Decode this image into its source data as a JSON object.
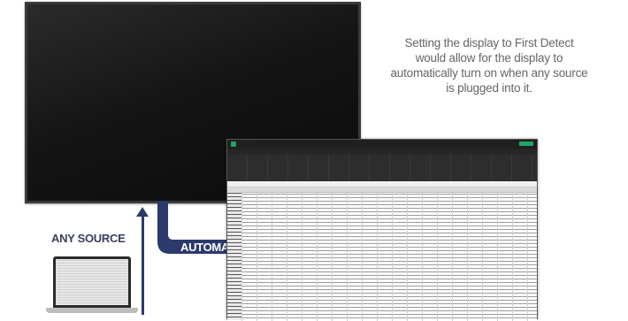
{
  "caption": "Setting the display to First Detect would allow for the display to automatically turn on when any source is plugged into it.",
  "labels": {
    "any_source": "ANY SOURCE",
    "automatic": "AUTOMATIC"
  },
  "colors": {
    "arrow": "#2b3a6b",
    "caption_text": "#666666",
    "excel_green": "#21a366"
  }
}
